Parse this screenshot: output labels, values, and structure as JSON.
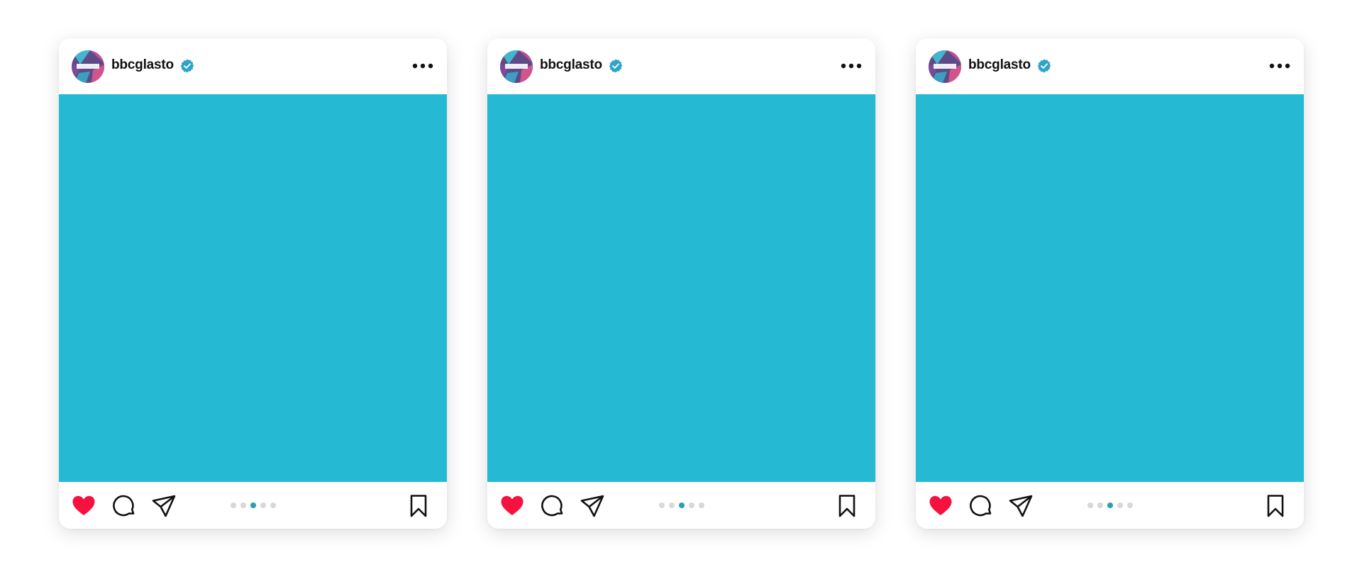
{
  "colors": {
    "media_background": "#26b9d4",
    "like_heart": "#f5123f",
    "verified_badge": "#2fa3c8",
    "active_dot": "#2a9fb0",
    "inactive_dot": "#d8d8d8"
  },
  "posts": [
    {
      "username": "bbcglasto",
      "verified_icon": "verified-badge-icon",
      "more_icon": "more-options-icon",
      "like_icon": "heart-filled-icon",
      "comment_icon": "comment-icon",
      "share_icon": "send-icon",
      "save_icon": "bookmark-icon",
      "carousel": {
        "count": 5,
        "active_index": 2
      }
    },
    {
      "username": "bbcglasto",
      "verified_icon": "verified-badge-icon",
      "more_icon": "more-options-icon",
      "like_icon": "heart-filled-icon",
      "comment_icon": "comment-icon",
      "share_icon": "send-icon",
      "save_icon": "bookmark-icon",
      "carousel": {
        "count": 5,
        "active_index": 2
      }
    },
    {
      "username": "bbcglasto",
      "verified_icon": "verified-badge-icon",
      "more_icon": "more-options-icon",
      "like_icon": "heart-filled-icon",
      "comment_icon": "comment-icon",
      "share_icon": "send-icon",
      "save_icon": "bookmark-icon",
      "carousel": {
        "count": 5,
        "active_index": 2
      }
    }
  ]
}
